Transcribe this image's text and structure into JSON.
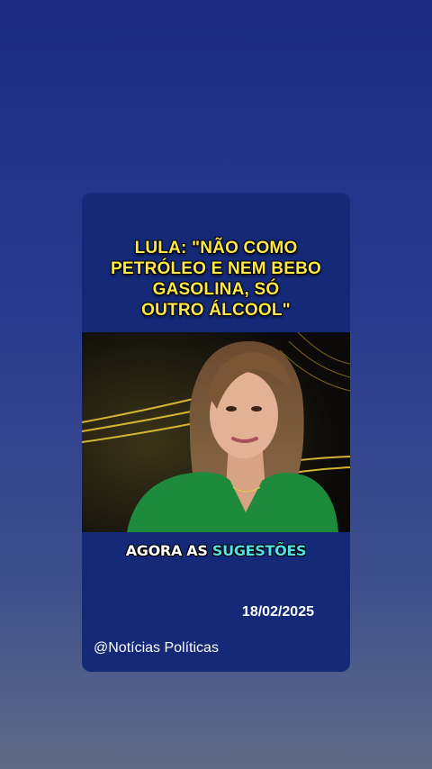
{
  "post": {
    "headline_lines": [
      "LULA: \"NÃO COMO",
      "PETRÓLEO E NEM BEBO",
      "GASOLINA, SÓ",
      "OUTRO ÁLCOOL\""
    ],
    "subtitle_prefix": "AGORA AS",
    "subtitle_highlight": "SUGESTÕES",
    "date": "18/02/2025",
    "handle": "@Notícias Políticas"
  },
  "colors": {
    "headline": "#ffe94a",
    "subtitle_highlight": "#4fe0e8",
    "card": "#142a78"
  }
}
